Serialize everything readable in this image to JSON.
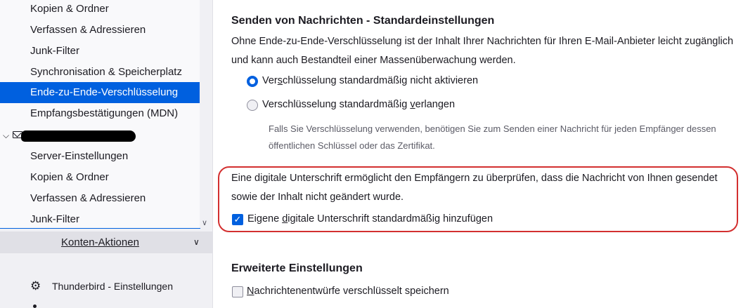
{
  "sidebar": {
    "items": [
      {
        "label": "Kopien & Ordner"
      },
      {
        "label": "Verfassen & Adressieren"
      },
      {
        "label": "Junk-Filter"
      },
      {
        "label": "Synchronisation & Speicherplatz"
      },
      {
        "label": "Ende-zu-Ende-Verschlüsselung",
        "selected": true
      },
      {
        "label": "Empfangsbestätigungen (MDN)"
      }
    ],
    "account2_items": [
      {
        "label": "Server-Einstellungen"
      },
      {
        "label": "Kopien & Ordner"
      },
      {
        "label": "Verfassen & Adressieren"
      },
      {
        "label": "Junk-Filter"
      }
    ],
    "account_actions_label": "Konten-Aktionen",
    "settings_label": "Thunderbird - Einstellungen",
    "icons": {
      "twisty": "chevron-down-icon",
      "account": "mail-icon",
      "settings": "gear-icon"
    }
  },
  "main": {
    "sending_heading": "Senden von Nachrichten - Standardeinstellungen",
    "sending_desc_line1": "Ohne Ende-zu-Ende-Verschlüsselung ist der Inhalt Ihrer Nachrichten für Ihren E-Mail-Anbieter leicht zugänglich",
    "sending_desc_line2": "und kann auch Bestandteil einer Massenüberwachung werden.",
    "radio_no_encrypt": {
      "pre": "Ver",
      "accel": "s",
      "post": "chlüsselung standardmäßig nicht aktivieren",
      "checked": true
    },
    "radio_require_encrypt": {
      "pre": "Verschlüsselung standardmäßig ",
      "accel": "v",
      "post": "erlangen",
      "checked": false
    },
    "encrypt_note_line1": "Falls Sie Verschlüsselung verwenden, benötigen Sie zum Senden einer Nachricht für jeden Empfänger dessen",
    "encrypt_note_line2": "öffentlichen Schlüssel oder das Zertifikat.",
    "signing_desc_line1": "Eine digitale Unterschrift ermöglicht den Empfängern zu überprüfen, dass die Nachricht von Ihnen gesendet",
    "signing_desc_line2": "sowie der Inhalt nicht geändert wurde.",
    "sign_checkbox": {
      "pre": "Eigene ",
      "accel": "d",
      "post": "igitale Unterschrift standardmäßig hinzufügen",
      "checked": true
    },
    "advanced_heading": "Erweiterte Einstellungen",
    "drafts_checkbox": {
      "pre": "",
      "accel": "N",
      "post": "achrichtenentwürfe verschlüsselt speichern",
      "checked": false
    },
    "colors": {
      "accent": "#0060df",
      "highlight_annotation": "#d32f2f"
    }
  }
}
